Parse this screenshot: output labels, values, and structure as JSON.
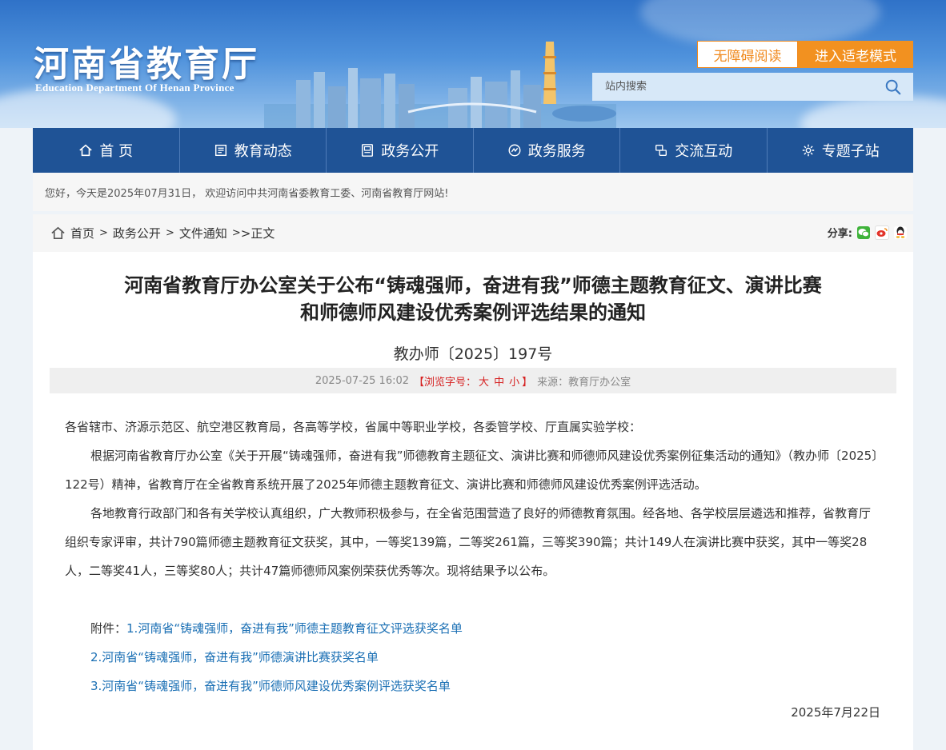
{
  "header": {
    "logo_cn": "河南省教育厅",
    "logo_en": "Education Department Of Henan Province",
    "accessibility_button": "无障碍阅读",
    "elder_mode_button": "进入适老模式",
    "search_placeholder": "站内搜索"
  },
  "nav": {
    "items": [
      {
        "label": "首 页",
        "icon": "home-icon"
      },
      {
        "label": "教育动态",
        "icon": "news-icon"
      },
      {
        "label": "政务公开",
        "icon": "document-icon"
      },
      {
        "label": "政务服务",
        "icon": "service-icon"
      },
      {
        "label": "交流互动",
        "icon": "interaction-icon"
      },
      {
        "label": "专题子站",
        "icon": "topic-icon"
      }
    ]
  },
  "welcome": "您好，今天是2025年07月31日， 欢迎访问中共河南省委教育工委、河南省教育厅网站!",
  "breadcrumb": {
    "items": [
      "首页",
      "政务公开",
      "文件通知"
    ],
    "separator": ">",
    "current": ">正文"
  },
  "share": {
    "label": "分享:",
    "targets": [
      "wechat-share-icon",
      "weibo-share-icon",
      "qq-share-icon"
    ]
  },
  "article": {
    "title_line1": "河南省教育厅办公室关于公布“铸魂强师，奋进有我”师德主题教育征文、演讲比赛",
    "title_line2": "和师德师风建设优秀案例评选结果的通知",
    "doc_number": "教办师〔2025〕197号",
    "date_time": "2025-07-25 16:02",
    "font_size_label": "【浏览字号：",
    "font_large": "大",
    "font_medium": "中",
    "font_small": "小",
    "font_size_close": "】",
    "source": "来源：教育厅办公室",
    "salutation": "各省辖市、济源示范区、航空港区教育局，各高等学校，省属中等职业学校，各委管学校、厅直属实验学校：",
    "paragraph1": "根据河南省教育厅办公室《关于开展“铸魂强师，奋进有我”师德教育主题征文、演讲比赛和师德师风建设优秀案例征集活动的通知》（教办师〔2025〕122号）精神，省教育厅在全省教育系统开展了2025年师德主题教育征文、演讲比赛和师德师风建设优秀案例评选活动。",
    "paragraph2": "各地教育行政部门和各有关学校认真组织，广大教师积极参与，在全省范围营造了良好的师德教育氛围。经各地、各学校层层遴选和推荐，省教育厅组织专家评审，共计790篇师德主题教育征文获奖，其中，一等奖139篇，二等奖261篇，三等奖390篇；共计149人在演讲比赛中获奖，其中一等奖28人，二等奖41人，三等奖80人；共计47篇师德师风案例荣获优秀等次。现将结果予以公布。",
    "attachment_label": "附件：",
    "attachments": [
      "1.河南省“铸魂强师，奋进有我”师德主题教育征文评选获奖名单",
      "2.河南省“铸魂强师，奋进有我”师德演讲比赛获奖名单",
      "3.河南省“铸魂强师，奋进有我”师德师风建设优秀案例评选获奖名单"
    ],
    "sign_date": "2025年7月22日"
  }
}
